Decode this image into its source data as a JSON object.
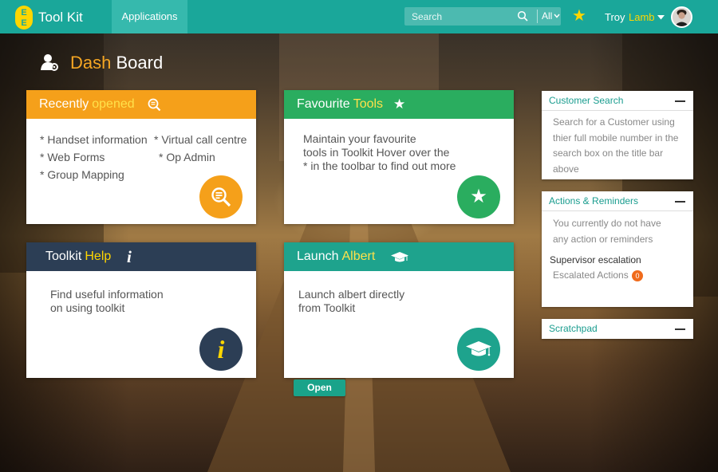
{
  "header": {
    "logo_letters": [
      "E",
      "E"
    ],
    "app_title": "Tool Kit",
    "nav_applications": "Applications",
    "search_placeholder": "Search",
    "search_scope": "All",
    "user_first": "Troy",
    "user_last": "Lamb"
  },
  "dashboard": {
    "title_part1": "Dash",
    "title_part2": "Board"
  },
  "cards": {
    "recent": {
      "title_part1": "Recently",
      "title_part2": "opened",
      "items": [
        "* Handset information",
        "* Virtual call centre",
        "* Web Forms",
        "* Op Admin",
        "* Group Mapping"
      ]
    },
    "favourite": {
      "title_part1": "Favourite",
      "title_part2": "Tools",
      "lines": [
        "Maintain your favourite",
        "tools in Toolkit Hover over the",
        "* in the toolbar to find out more"
      ]
    },
    "help": {
      "title_part1": "Toolkit",
      "title_part2": "Help",
      "lines": [
        "Find useful information",
        "on using toolkit"
      ]
    },
    "albert": {
      "title_part1": "Launch",
      "title_part2": "Albert",
      "lines": [
        "Launch albert directly",
        "from Toolkit"
      ],
      "open_label": "Open"
    }
  },
  "side": {
    "customer_search": {
      "title": "Customer Search",
      "lines": [
        "Search for a Customer using",
        "thier full mobile number in the",
        "search box on the title bar",
        "above"
      ]
    },
    "actions": {
      "title": "Actions & Reminders",
      "lines": [
        "You currently do not have",
        "any action or reminders"
      ],
      "supervisor": "Supervisor escalation",
      "escalated": "Escalated Actions",
      "escalated_count": "0"
    },
    "scratchpad": {
      "title": "Scratchpad"
    }
  },
  "colors": {
    "brand_teal": "#1aa79a",
    "brand_yellow": "#ffd600",
    "recent_orange": "#f5a01a",
    "favourite_green": "#2aad5f",
    "help_navy": "#2c3e55",
    "albert_teal": "#1ea38d",
    "badge_orange": "#f06b1c"
  },
  "icons": {
    "logo": "ee-logo-icon",
    "search": "search-icon",
    "star": "star-icon",
    "user_badge": "user-gear-icon",
    "magnifier": "search-document-icon",
    "info": "info-icon",
    "mortarboard": "graduation-cap-icon",
    "minus": "minus-icon"
  }
}
